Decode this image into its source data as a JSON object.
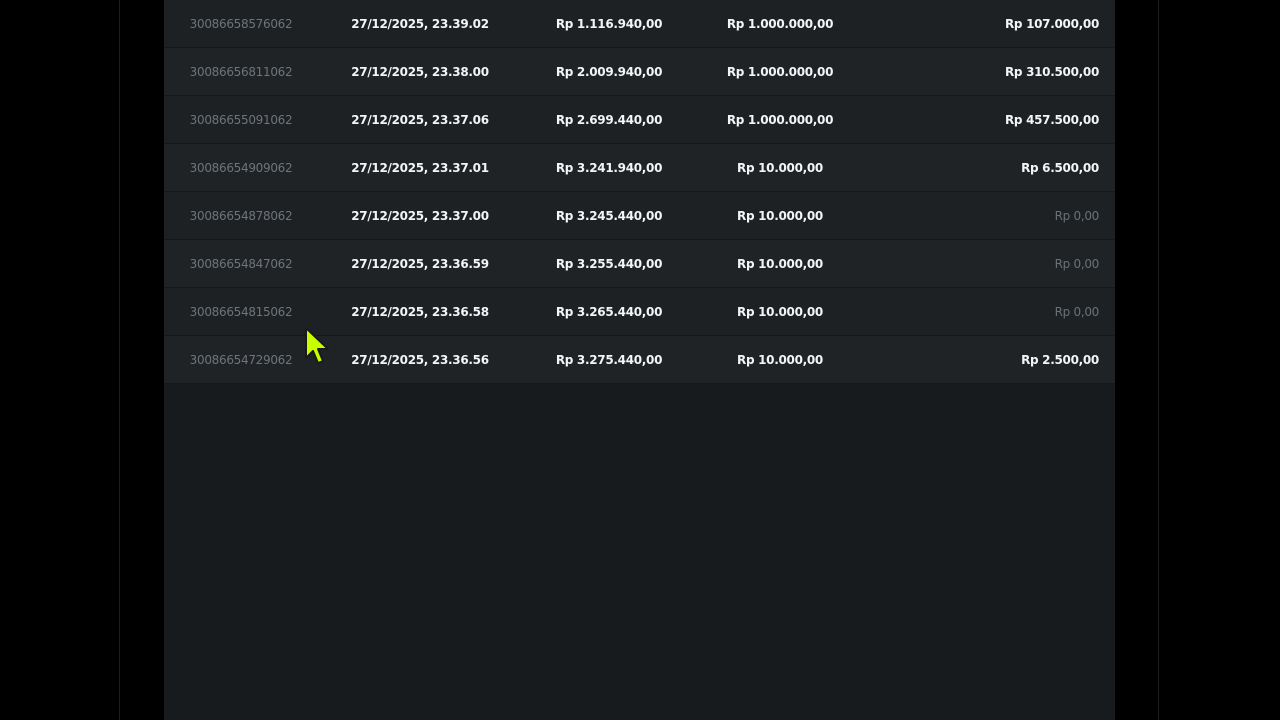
{
  "transactions": [
    {
      "id": "30086658576062",
      "date": "27/12/2025, 23.39.02",
      "balance": "Rp 1.116.940,00",
      "bet": "Rp 1.000.000,00",
      "win": "Rp 107.000,00",
      "win_zero": false
    },
    {
      "id": "30086656811062",
      "date": "27/12/2025, 23.38.00",
      "balance": "Rp 2.009.940,00",
      "bet": "Rp 1.000.000,00",
      "win": "Rp 310.500,00",
      "win_zero": false
    },
    {
      "id": "30086655091062",
      "date": "27/12/2025, 23.37.06",
      "balance": "Rp 2.699.440,00",
      "bet": "Rp 1.000.000,00",
      "win": "Rp 457.500,00",
      "win_zero": false
    },
    {
      "id": "30086654909062",
      "date": "27/12/2025, 23.37.01",
      "balance": "Rp 3.241.940,00",
      "bet": "Rp 10.000,00",
      "win": "Rp 6.500,00",
      "win_zero": false
    },
    {
      "id": "30086654878062",
      "date": "27/12/2025, 23.37.00",
      "balance": "Rp 3.245.440,00",
      "bet": "Rp 10.000,00",
      "win": "Rp 0,00",
      "win_zero": true
    },
    {
      "id": "30086654847062",
      "date": "27/12/2025, 23.36.59",
      "balance": "Rp 3.255.440,00",
      "bet": "Rp 10.000,00",
      "win": "Rp 0,00",
      "win_zero": true
    },
    {
      "id": "30086654815062",
      "date": "27/12/2025, 23.36.58",
      "balance": "Rp 3.265.440,00",
      "bet": "Rp 10.000,00",
      "win": "Rp 0,00",
      "win_zero": true
    },
    {
      "id": "30086654729062",
      "date": "27/12/2025, 23.36.56",
      "balance": "Rp 3.275.440,00",
      "bet": "Rp 10.000,00",
      "win": "Rp 2.500,00",
      "win_zero": false
    }
  ],
  "colors": {
    "background": "#000000",
    "panel": "#181b1e",
    "row": "#1d2124",
    "text_primary": "#f2f4f5",
    "text_muted": "#6e7479",
    "cursor": "#c8ff00"
  },
  "icons": {
    "cursor": "mouse-pointer-icon"
  }
}
